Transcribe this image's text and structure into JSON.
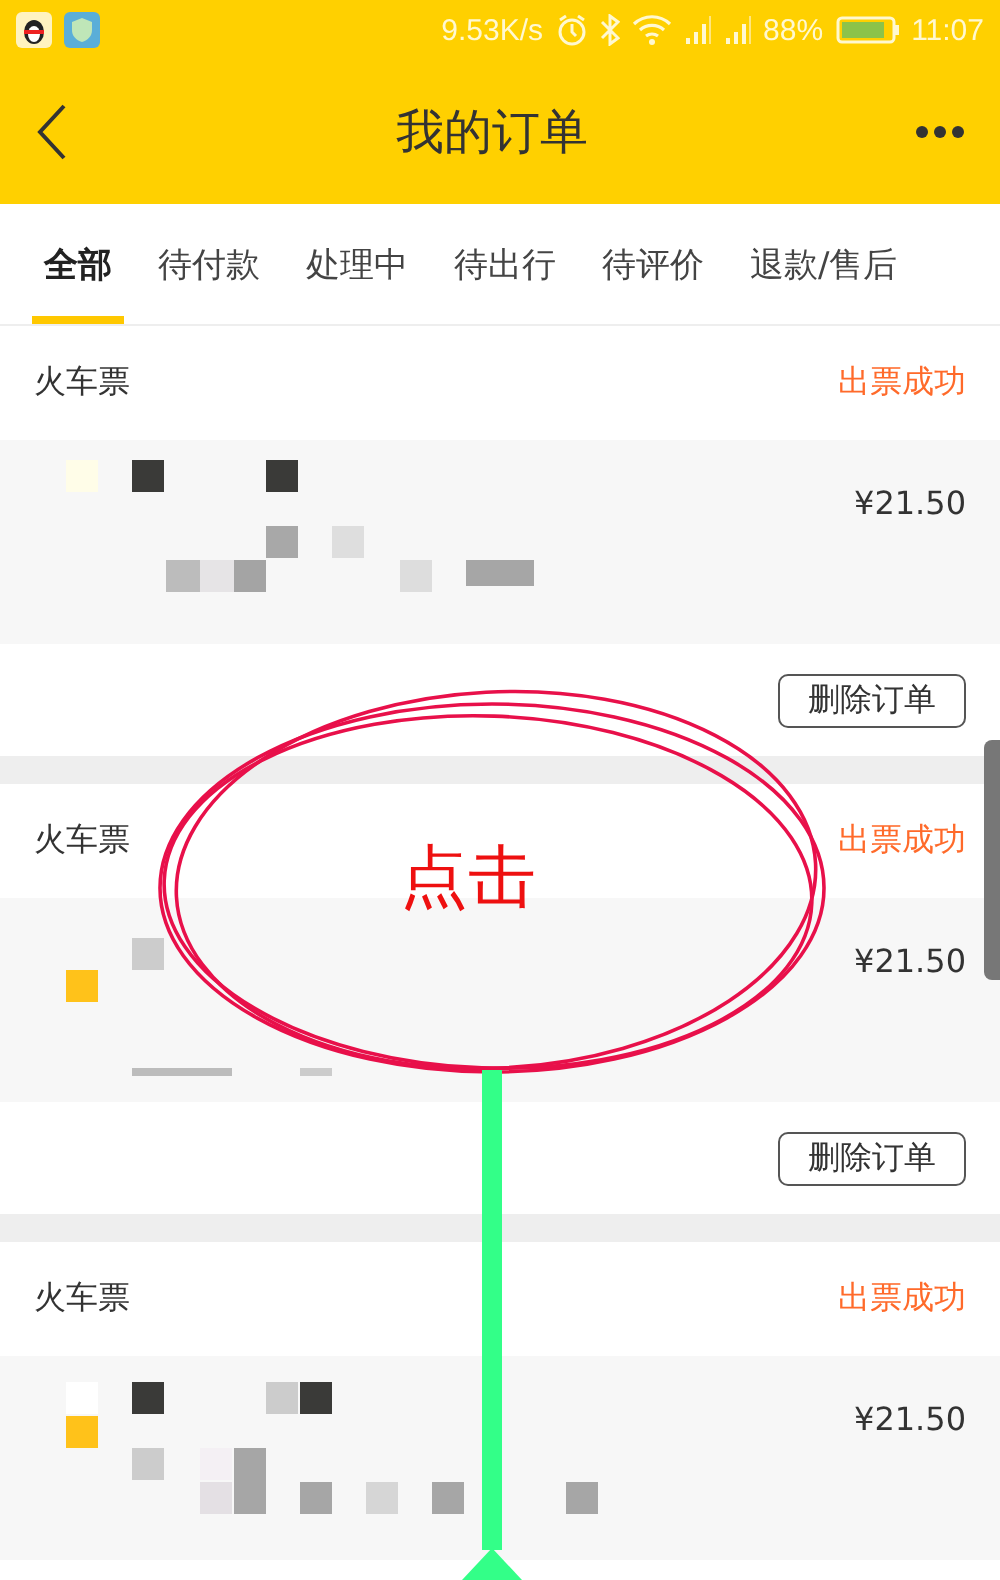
{
  "status_bar": {
    "network_speed": "9.53K/s",
    "battery": "88%",
    "time": "11:07"
  },
  "header": {
    "title": "我的订单"
  },
  "tabs": [
    {
      "label": "全部",
      "selected": true
    },
    {
      "label": "待付款",
      "selected": false
    },
    {
      "label": "处理中",
      "selected": false
    },
    {
      "label": "待出行",
      "selected": false
    },
    {
      "label": "待评价",
      "selected": false
    },
    {
      "label": "退款/售后",
      "selected": false
    }
  ],
  "orders": [
    {
      "category": "火车票",
      "status": "出票成功",
      "price": "¥21.50",
      "action": "删除订单"
    },
    {
      "category": "火车票",
      "status": "出票成功",
      "price": "¥21.50",
      "action": "删除订单"
    },
    {
      "category": "火车票",
      "status": "出票成功",
      "price": "¥21.50"
    }
  ],
  "annotation": {
    "label": "点击"
  }
}
